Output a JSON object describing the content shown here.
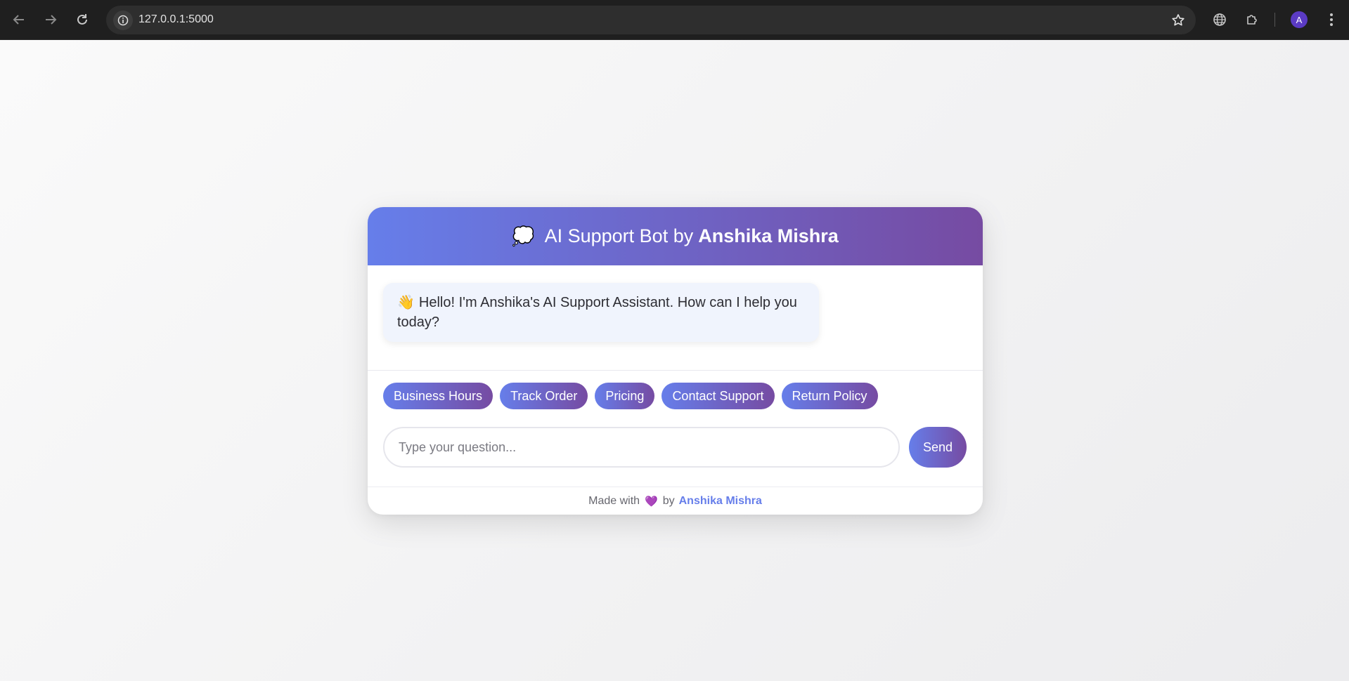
{
  "browser": {
    "url": "127.0.0.1:5000",
    "profile_initial": "A",
    "icons": {
      "back": "arrow-left-icon",
      "forward": "arrow-right-icon",
      "reload": "reload-icon",
      "site_info": "info-icon",
      "bookmark": "star-icon",
      "translate": "globe-icon",
      "extensions": "puzzle-icon",
      "menu": "kebab-menu-icon"
    }
  },
  "chat": {
    "header": {
      "icon": "💭",
      "title_prefix": "AI Support Bot by",
      "title_name": "Anshika Mishra"
    },
    "greeting": {
      "icon": "👋",
      "text": "Hello! I'm Anshika's AI Support Assistant. How can I help you today?"
    },
    "quick_replies": [
      "Business Hours",
      "Track Order",
      "Pricing",
      "Contact Support",
      "Return Policy"
    ],
    "input": {
      "placeholder": "Type your question...",
      "value": ""
    },
    "send_label": "Send",
    "footer": {
      "prefix": "Made with",
      "heart": "💜",
      "by": "by",
      "author": "Anshika Mishra"
    }
  },
  "colors": {
    "gradient_start": "#667eea",
    "gradient_end": "#764ba2",
    "bubble_bg": "#f0f4fd"
  }
}
